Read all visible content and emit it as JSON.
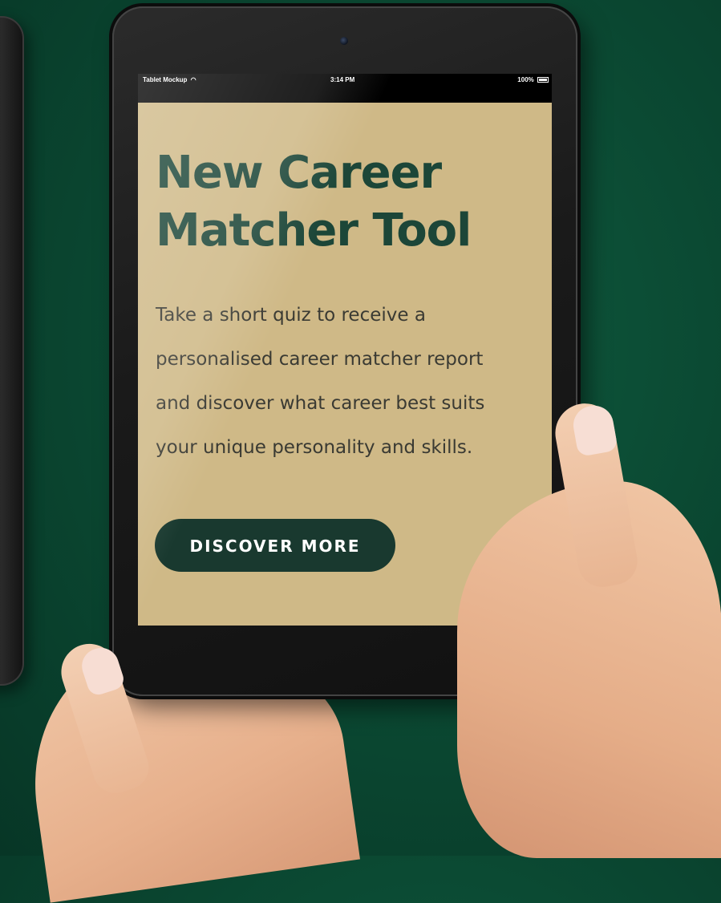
{
  "status_bar": {
    "carrier": "Tablet Mockup",
    "time": "3:14 PM",
    "battery": "100%"
  },
  "hero": {
    "title_line_1": "New Career",
    "title_line_2": "Matcher Tool",
    "body_line_1": "Take a short quiz to receive a",
    "body_line_2": "personalised career matcher report",
    "body_line_3": "and discover what career best suits",
    "body_line_4": "your unique personality and skills."
  },
  "cta": {
    "label": "DISCOVER MORE"
  },
  "colors": {
    "background": "#0b4a33",
    "screen_bg": "#cfb987",
    "title": "#1c4638",
    "button_bg": "#19392f",
    "button_text": "#ffffff"
  },
  "icons": [
    "wifi-icon",
    "battery-icon",
    "camera-icon"
  ]
}
